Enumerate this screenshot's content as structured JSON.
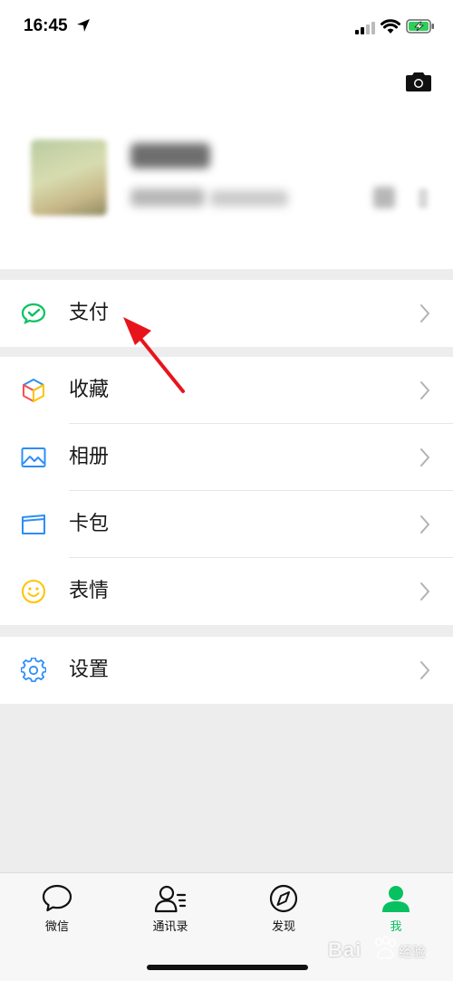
{
  "status_bar": {
    "time": "16:45"
  },
  "menu": {
    "pay": {
      "label": "支付"
    },
    "favorites": {
      "label": "收藏"
    },
    "album": {
      "label": "相册"
    },
    "cards": {
      "label": "卡包"
    },
    "stickers": {
      "label": "表情"
    },
    "settings": {
      "label": "设置"
    }
  },
  "tabbar": {
    "tabs": [
      {
        "label": "微信",
        "icon": "chat-bubble-icon",
        "active": false
      },
      {
        "label": "通讯录",
        "icon": "contacts-icon",
        "active": false
      },
      {
        "label": "发现",
        "icon": "compass-icon",
        "active": false
      },
      {
        "label": "我",
        "icon": "person-icon",
        "active": true
      }
    ]
  },
  "watermark": {
    "brand": "Bai",
    "sub": "经验"
  },
  "colors": {
    "accent_green": "#07c160",
    "background": "#ededed",
    "annotation_arrow": "#e8141b"
  }
}
